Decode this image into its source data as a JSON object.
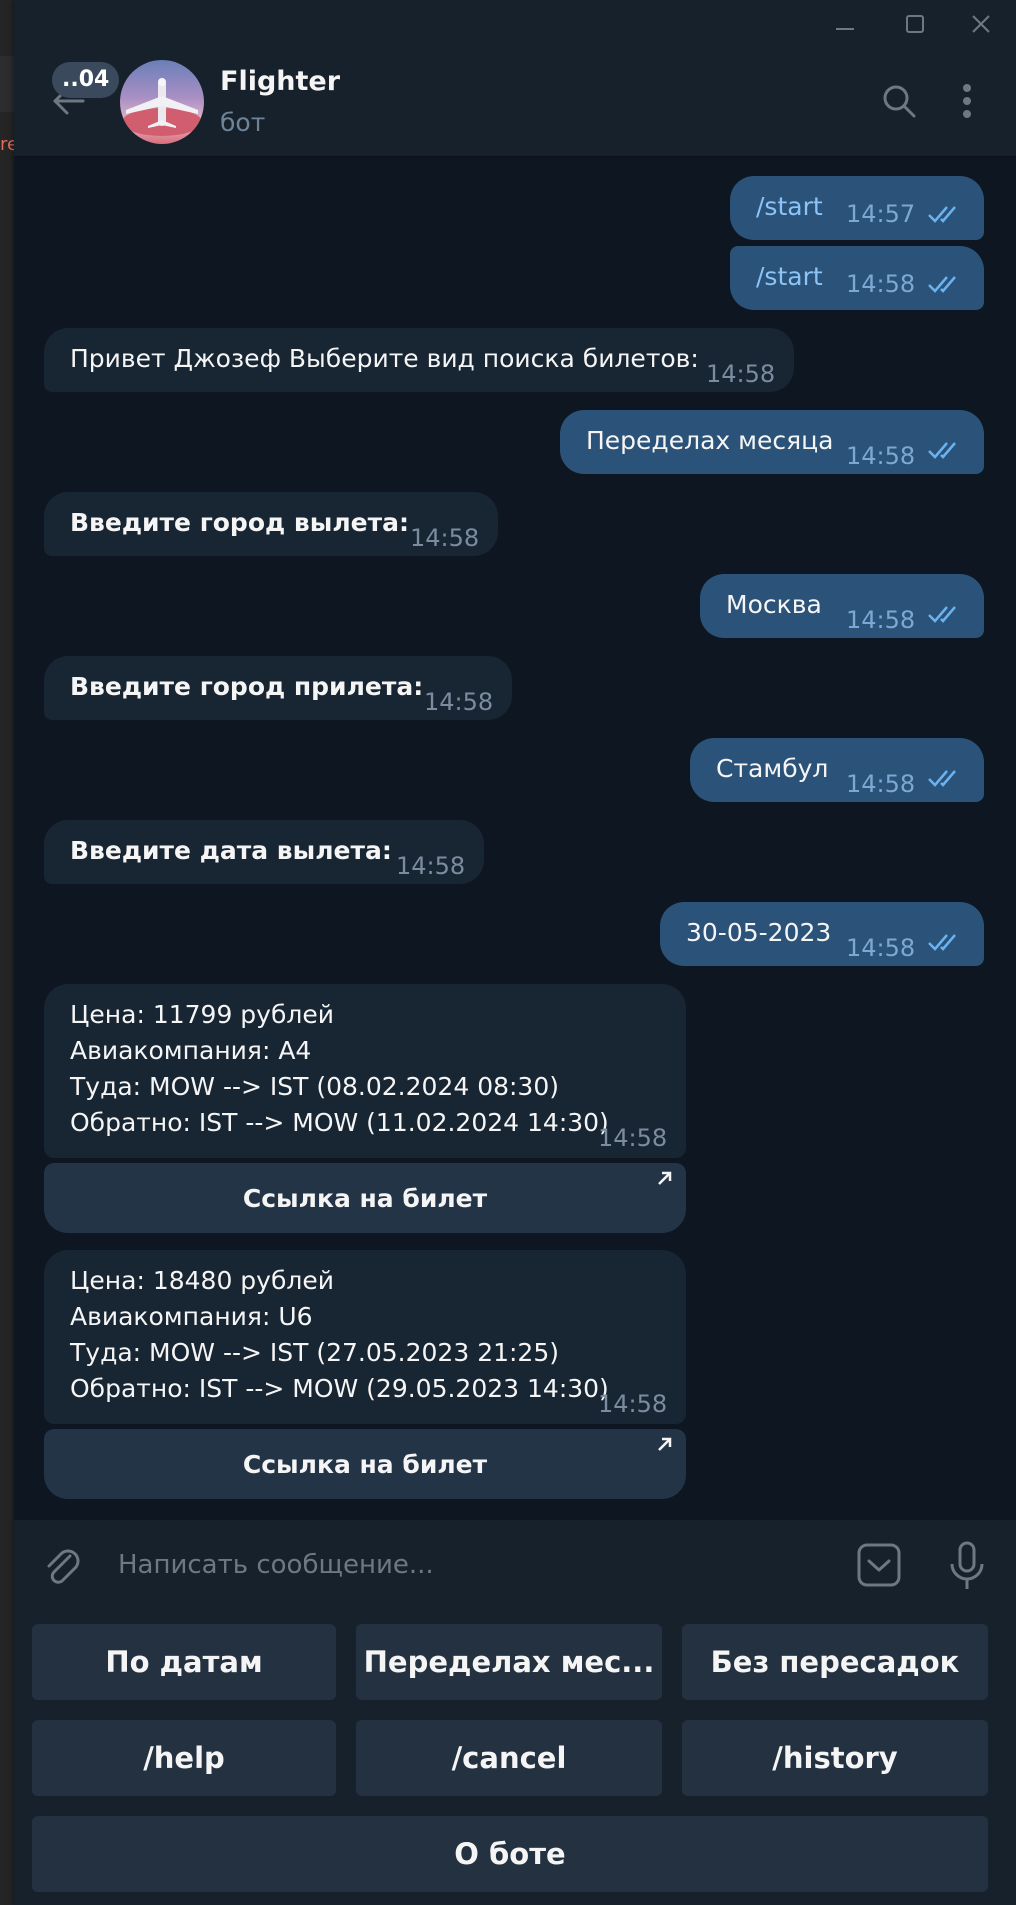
{
  "header": {
    "badge": "..04",
    "title": "Flighter",
    "subtitle": "бот"
  },
  "messages": [
    {
      "text": "/start",
      "time": "14:57"
    },
    {
      "text": "/start",
      "time": "14:58"
    },
    {
      "text": "Привет Джозеф Выберите вид поиска билетов:",
      "time": "14:58"
    },
    {
      "text": "Переделах месяца",
      "time": "14:58"
    },
    {
      "text": "Введите город вылета:",
      "time": "14:58"
    },
    {
      "text": "Москва",
      "time": "14:58"
    },
    {
      "text": "Введите город прилета:",
      "time": "14:58"
    },
    {
      "text": "Стамбул",
      "time": "14:58"
    },
    {
      "text": "Введите дата вылета:",
      "time": "14:58"
    },
    {
      "text": "30-05-2023",
      "time": "14:58"
    }
  ],
  "tickets": [
    {
      "lines": [
        "Цена: 11799 рублей",
        "Авиакомпания: A4",
        "Туда: MOW --> IST (08.02.2024 08:30)",
        "Обратно: IST --> MOW (11.02.2024 14:30)"
      ],
      "time": "14:58",
      "button": "Ссылка на билет"
    },
    {
      "lines": [
        "Цена: 18480 рублей",
        "Авиакомпания: U6",
        "Туда: MOW --> IST (27.05.2023 21:25)",
        "Обратно: IST --> MOW (29.05.2023 14:30)"
      ],
      "time": "14:58",
      "button": "Ссылка на билет"
    }
  ],
  "composer": {
    "placeholder": "Написать сообщение..."
  },
  "keyboard": {
    "row1": [
      "По датам",
      "Переделах мес...",
      "Без пересадок"
    ],
    "row2": [
      "/help",
      "/cancel",
      "/history"
    ],
    "row3": [
      "О боте"
    ]
  },
  "colors": {
    "chat_bg": "#0e1621",
    "outgoing": "#2b5278",
    "incoming": "#182533",
    "panel": "#17212b",
    "accent": "#6ab3f3"
  }
}
